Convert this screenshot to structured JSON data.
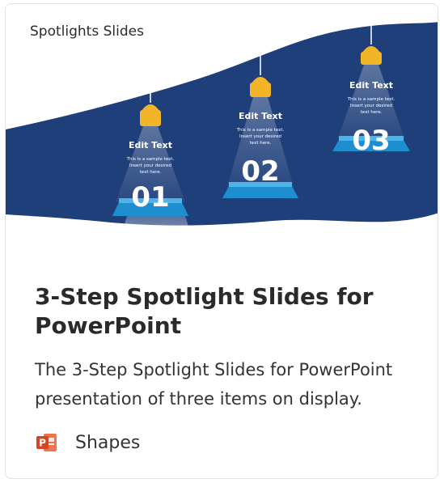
{
  "thumbnail": {
    "label": "Spotlights Slides",
    "steps": [
      {
        "title": "Edit Text",
        "desc_lines": [
          "This is a sample text.",
          "Insert your desired",
          "text here."
        ],
        "number": "01"
      },
      {
        "title": "Edit Text",
        "desc_lines": [
          "This is a sample text.",
          "Insert your desired",
          "text here."
        ],
        "number": "02"
      },
      {
        "title": "Edit Text",
        "desc_lines": [
          "This is a sample text.",
          "Insert your desired",
          "text here."
        ],
        "number": "03"
      }
    ],
    "colors": {
      "background": "#1f3f7a",
      "lamp": "#f2b429",
      "platform": "#1d8fd1"
    }
  },
  "card": {
    "title": "3-Step Spotlight Slides for PowerPoint",
    "description": "The 3-Step Spotlight Slides for PowerPoint presentation of three items on display.",
    "category": "Shapes",
    "category_icon": "powerpoint-icon"
  }
}
